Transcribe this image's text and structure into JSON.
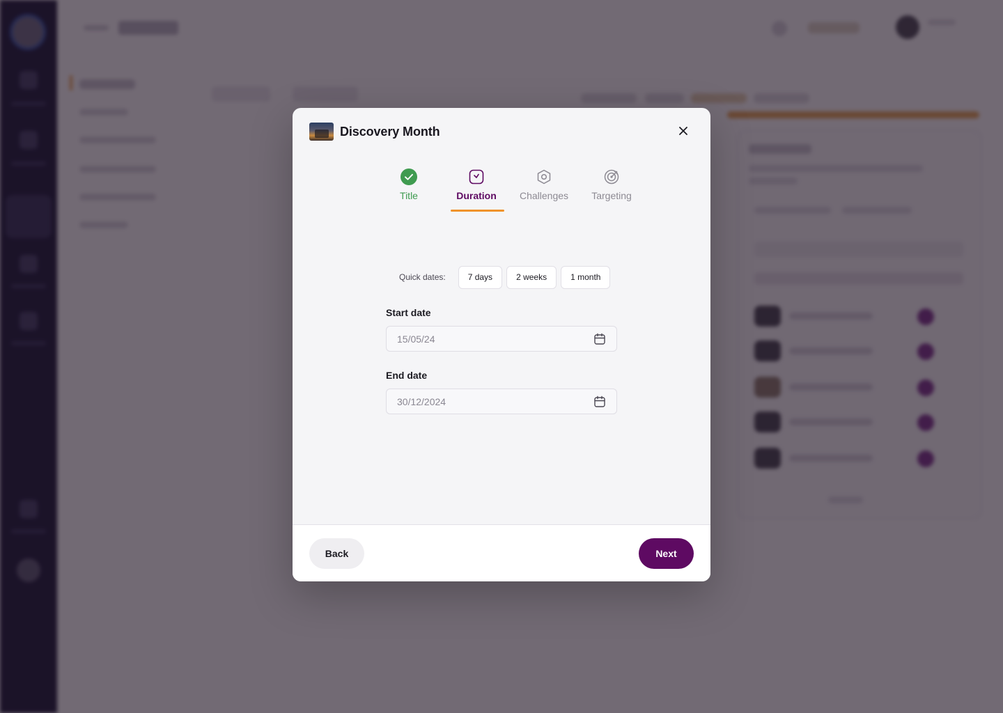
{
  "modal": {
    "title": "Discovery Month",
    "thumbnail": "event-thumbnail-image",
    "close_icon": "close-icon"
  },
  "steps": [
    {
      "label": "Title",
      "icon": "check-circle-icon",
      "state": "completed"
    },
    {
      "label": "Duration",
      "icon": "clock-icon",
      "state": "active"
    },
    {
      "label": "Challenges",
      "icon": "hexagon-icon",
      "state": "pending"
    },
    {
      "label": "Targeting",
      "icon": "target-icon",
      "state": "pending"
    }
  ],
  "quick_dates": {
    "label": "Quick dates:",
    "options": [
      "7 days",
      "2 weeks",
      "1 month"
    ]
  },
  "start_date": {
    "label": "Start date",
    "placeholder": "15/05/24"
  },
  "end_date": {
    "label": "End date",
    "placeholder": "30/12/2024"
  },
  "footer": {
    "back_label": "Back",
    "next_label": "Next"
  },
  "colors": {
    "primary": "#5e0a62",
    "accent": "#f0932b",
    "success": "#3f9b50",
    "pending": "#8d8a93"
  }
}
